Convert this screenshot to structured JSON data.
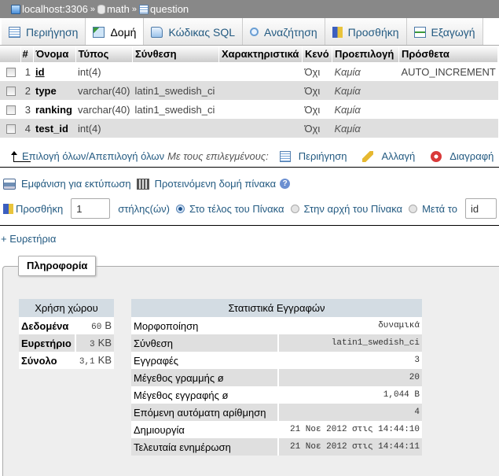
{
  "breadcrumb": {
    "server": "localhost:3306",
    "database": "math",
    "table": "question",
    "separator": "»"
  },
  "tabs": [
    {
      "label": "Περιήγηση",
      "icon": "browse-icon",
      "active": false
    },
    {
      "label": "Δομή",
      "icon": "structure-icon",
      "active": true
    },
    {
      "label": "Κώδικας SQL",
      "icon": "sql-icon",
      "active": false
    },
    {
      "label": "Αναζήτηση",
      "icon": "search-icon",
      "active": false
    },
    {
      "label": "Προσθήκη",
      "icon": "insert-icon",
      "active": false
    },
    {
      "label": "Εξαγωγή",
      "icon": "export-icon",
      "active": false
    }
  ],
  "structure": {
    "headers": [
      "#",
      "Όνομα",
      "Τύπος",
      "Σύνθεση",
      "Χαρακτηριστικά",
      "Κενό",
      "Προεπιλογή",
      "Πρόσθετα"
    ],
    "rows": [
      {
        "num": "1",
        "name": "id",
        "type": "int(4)",
        "collation": "",
        "attributes": "",
        "null": "Όχι",
        "default": "Καμία",
        "extra": "AUTO_INCREMENT",
        "primary": true
      },
      {
        "num": "2",
        "name": "type",
        "type": "varchar(40)",
        "collation": "latin1_swedish_ci",
        "attributes": "",
        "null": "Όχι",
        "default": "Καμία",
        "extra": "",
        "primary": false
      },
      {
        "num": "3",
        "name": "ranking",
        "type": "varchar(40)",
        "collation": "latin1_swedish_ci",
        "attributes": "",
        "null": "Όχι",
        "default": "Καμία",
        "extra": "",
        "primary": false
      },
      {
        "num": "4",
        "name": "test_id",
        "type": "int(4)",
        "collation": "",
        "attributes": "",
        "null": "Όχι",
        "default": "Καμία",
        "extra": "",
        "primary": false
      }
    ]
  },
  "selection": {
    "check_all": "Επιλογή όλων",
    "divider": " / ",
    "uncheck_all": "Απεπιλογή όλων",
    "with_selected": "Με τους επιλεγμένους:",
    "actions": [
      "Περιήγηση",
      "Αλλαγή",
      "Διαγραφή"
    ]
  },
  "print_view": "Εμφάνιση για εκτύπωση",
  "propose_structure": "Προτεινόμενη δομή πίνακα",
  "help_glyph": "?",
  "add_column": {
    "label": "Προσθήκη",
    "count": "1",
    "columns_label": "στήλης(ών)",
    "options": [
      {
        "label": "Στο τέλος του Πίνακα",
        "selected": true
      },
      {
        "label": "Στην αρχή του Πίνακα",
        "selected": false
      },
      {
        "label": "Μετά το",
        "selected": false
      }
    ],
    "after_value": "id"
  },
  "indexes_link": "+ Ευρετήρια",
  "info": {
    "legend": "Πληροφορία",
    "space_usage": {
      "title": "Χρήση χώρου",
      "rows": [
        {
          "label": "Δεδομένα",
          "value": "60",
          "unit": "B"
        },
        {
          "label": "Ευρετήριο",
          "value": "3",
          "unit": "KB"
        },
        {
          "label": "Σύνολο",
          "value": "3,1",
          "unit": "KB"
        }
      ]
    },
    "row_stats": {
      "title": "Στατιστικά Εγγραφών",
      "rows": [
        {
          "label": "Μορφοποίηση",
          "value": "δυναμικά"
        },
        {
          "label": "Σύνθεση",
          "value": "latin1_swedish_ci"
        },
        {
          "label": "Εγγραφές",
          "value": "3"
        },
        {
          "label": "Μέγεθος γραμμής ø",
          "value": "20"
        },
        {
          "label": "Μέγεθος εγγραφής ø",
          "value": "1,044 B"
        },
        {
          "label": "Επόμενη αυτόματη αρίθμηση",
          "value": "4"
        },
        {
          "label": "Δημιουργία",
          "value": "21 Νοε 2012 στις 14:44:10"
        },
        {
          "label": "Τελευταία ενημέρωση",
          "value": "21 Νοε 2012 στις 14:44:11"
        }
      ]
    }
  }
}
